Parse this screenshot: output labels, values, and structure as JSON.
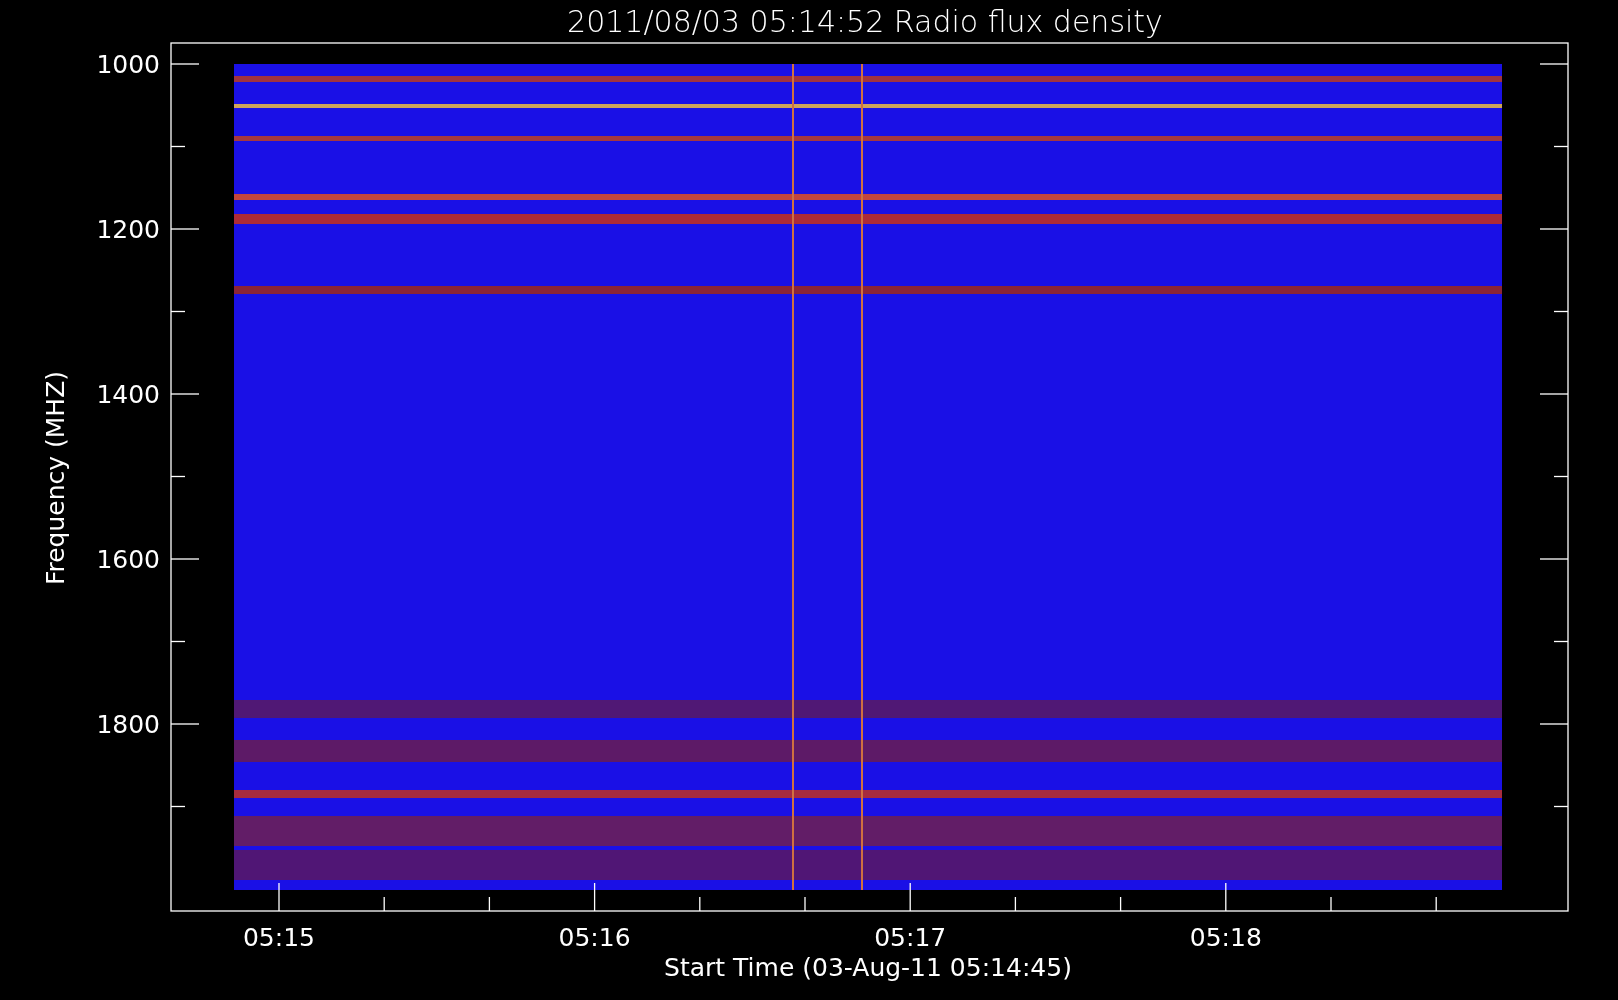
{
  "title": "2011/08/03 05:14:52 Radio flux density",
  "y_axis": {
    "label": "Frequency (MHZ)",
    "ticks": [
      "1000",
      "1200",
      "1400",
      "1600",
      "1800"
    ]
  },
  "x_axis": {
    "label": "Start Time (03-Aug-11 05:14:45)",
    "ticks": [
      "05:15",
      "05:16",
      "05:17",
      "05:18"
    ]
  }
}
